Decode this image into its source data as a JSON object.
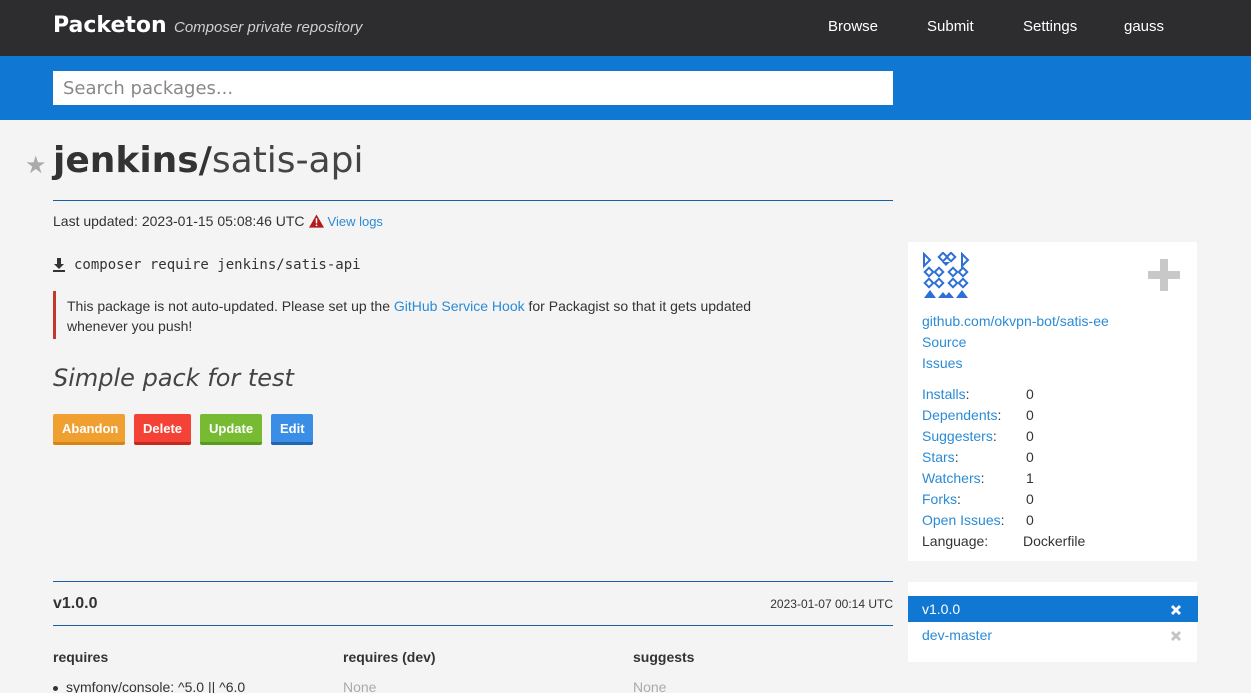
{
  "header": {
    "brand": "Packeton",
    "tagline": "Composer private repository",
    "nav": [
      "Browse",
      "Submit",
      "Settings",
      "gauss"
    ]
  },
  "search": {
    "placeholder": "Search packages..."
  },
  "package": {
    "vendor": "jenkins/",
    "name": "satis-api",
    "last_updated_label": "Last updated:",
    "last_updated": "2023-01-15 05:08:46 UTC",
    "view_logs": "View logs",
    "require_cmd": "composer require jenkins/satis-api",
    "notice_before": "This package is not auto-updated. Please set up the ",
    "notice_link": "GitHub Service Hook",
    "notice_after": " for Packagist so that it gets updated whenever you push!",
    "description": "Simple pack for test",
    "buttons": {
      "abandon": "Abandon",
      "delete": "Delete",
      "update": "Update",
      "edit": "Edit"
    }
  },
  "sidebar": {
    "repo_url": "github.com/okvpn-bot/satis-ee",
    "source": "Source",
    "issues": "Issues",
    "stats": [
      {
        "label": "Installs",
        "value": "0"
      },
      {
        "label": "Dependents",
        "value": "0"
      },
      {
        "label": "Suggesters",
        "value": "0"
      },
      {
        "label": "Stars",
        "value": "0"
      },
      {
        "label": "Watchers",
        "value": "1"
      },
      {
        "label": "Forks",
        "value": "0"
      },
      {
        "label": "Open Issues",
        "value": "0"
      }
    ],
    "language_label": "Language:",
    "language": "Dockerfile"
  },
  "version": {
    "name": "v1.0.0",
    "date": "2023-01-07 00:14 UTC",
    "requires_head": "requires",
    "requires_dev_head": "requires (dev)",
    "suggests_head": "suggests",
    "requires": [
      "symfony/console: ^5.0 || ^6.0"
    ],
    "requires_dev": "None",
    "suggests": "None"
  },
  "versions_list": [
    "v1.0.0",
    "dev-master"
  ],
  "colors": {
    "topbar": "#2d2d2f",
    "search_band": "#1077d3",
    "link": "#2a8bd6"
  }
}
